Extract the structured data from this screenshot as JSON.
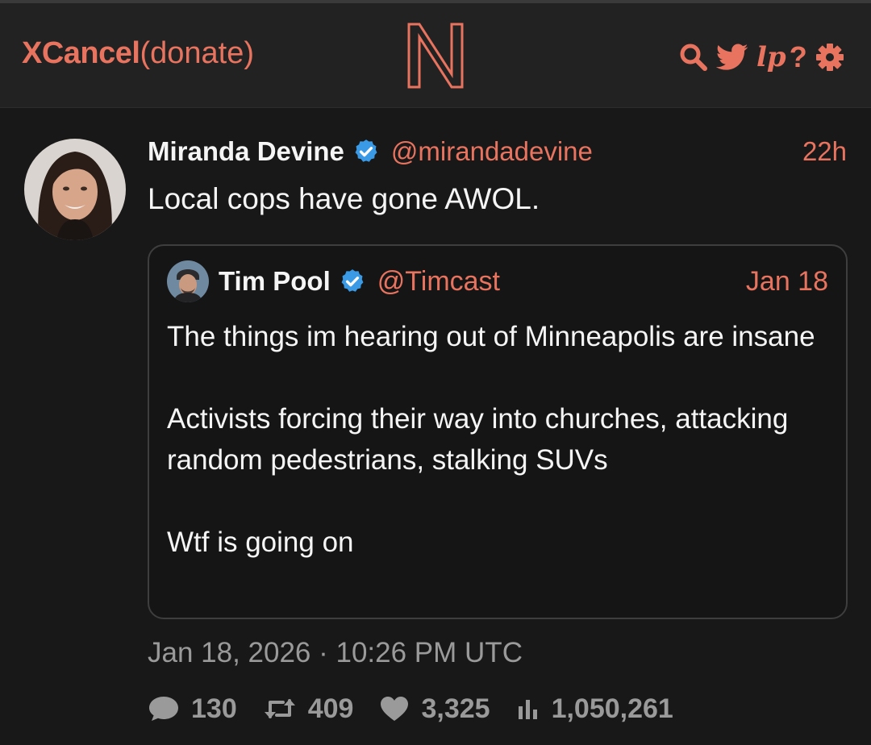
{
  "header": {
    "brand_name": "XCancel",
    "brand_donate": "(donate)",
    "logo_letter": "N",
    "icons": [
      "search-icon",
      "twitter-bird-icon",
      "lp-icon",
      "help-icon",
      "gear-icon"
    ],
    "lp_label": "lp",
    "help_label": "?",
    "accent_color": "#e8735f"
  },
  "tweet": {
    "author_name": "Miranda Devine",
    "handle": "@mirandadevine",
    "time": "22h",
    "text": "Local cops have gone AWOL.",
    "verified": true,
    "quote": {
      "author_name": "Tim Pool",
      "handle": "@Timcast",
      "time": "Jan 18",
      "verified": true,
      "paragraphs": [
        "The things im hearing out of Minneapolis are insane",
        "Activists forcing their way into churches, attacking random pedestrians, stalking SUVs",
        "Wtf is going on"
      ]
    },
    "date": "Jan 18, 2026 · 10:26 PM UTC",
    "stats": {
      "replies": "130",
      "retweets": "409",
      "likes": "3,325",
      "views": "1,050,261"
    }
  }
}
